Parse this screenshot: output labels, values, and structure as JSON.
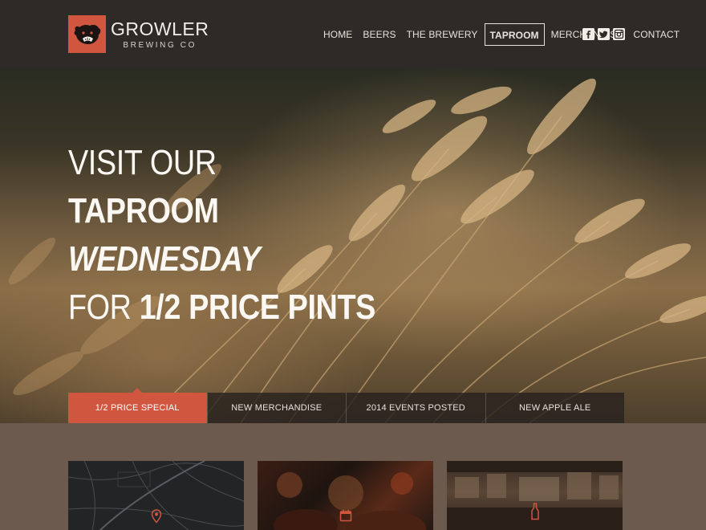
{
  "brand": {
    "name": "GROWLER",
    "subtitle": "BREWING CO",
    "accent": "#d0563f"
  },
  "nav": {
    "items": [
      "HOME",
      "BEERS",
      "THE BREWERY",
      "TAPROOM",
      "MERCHANDISE",
      "CONTACT"
    ],
    "active": "TAPROOM"
  },
  "social": {
    "facebook": "f",
    "twitter": "t",
    "instagram": "ig"
  },
  "hero": {
    "line1": "VISIT OUR",
    "line2": "TAPROOM",
    "line3": "WEDNESDAY",
    "line4_prefix": "FOR",
    "line4_bold": "1/2 PRICE PINTS"
  },
  "tabs": {
    "items": [
      "1/2 PRICE SPECIAL",
      "NEW MERCHANDISE",
      "2014 EVENTS POSTED",
      "NEW APPLE ALE"
    ],
    "active": "1/2 PRICE SPECIAL"
  },
  "cards": {
    "map_icon": "map-pin-icon",
    "events_icon": "calendar-icon",
    "taproom_icon": "bottle-icon"
  }
}
